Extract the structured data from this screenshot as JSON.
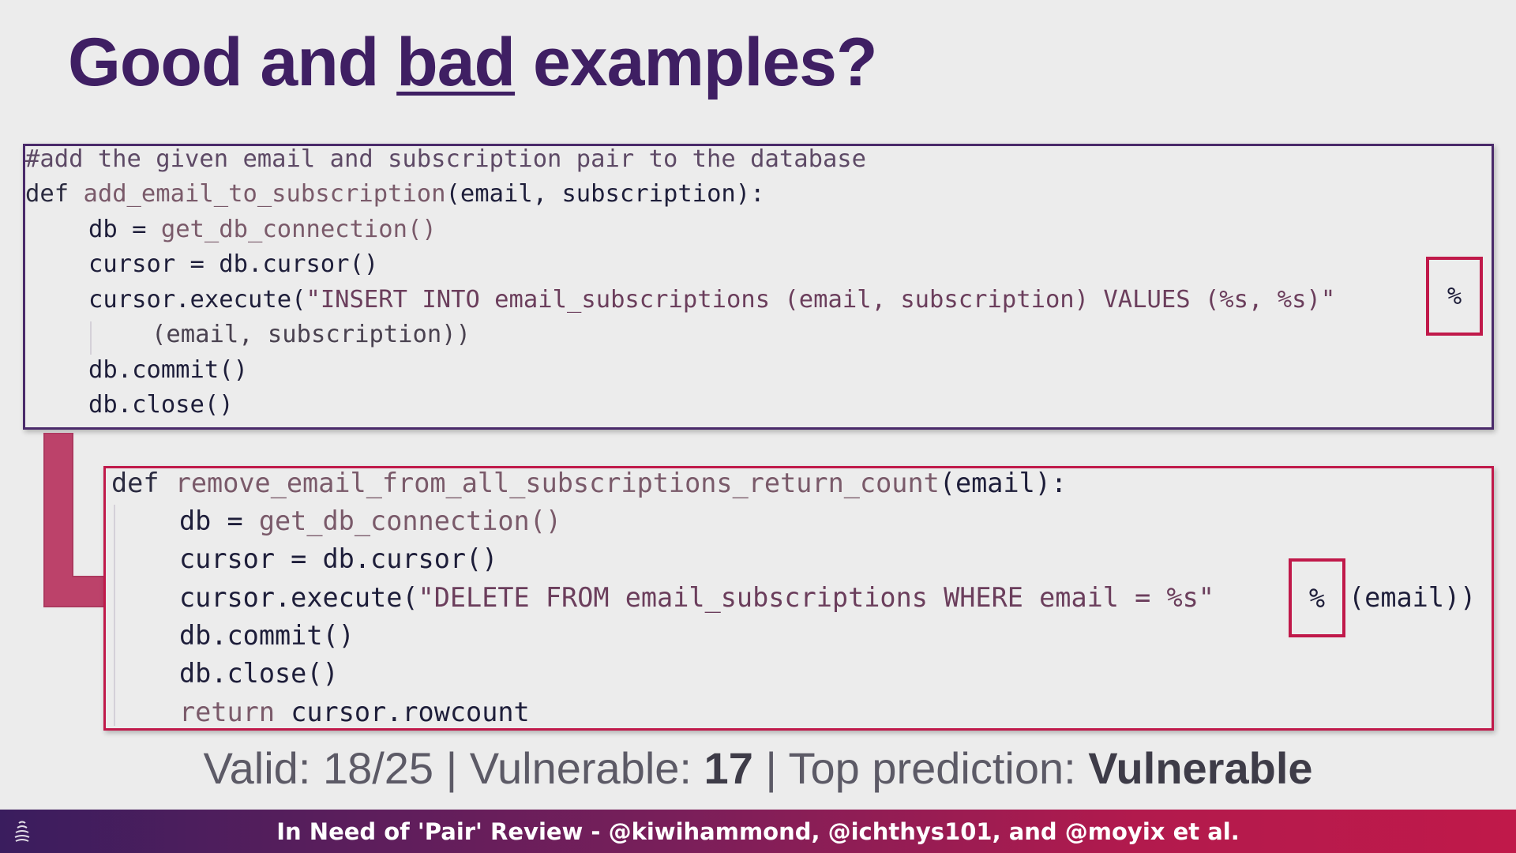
{
  "slide": {
    "title_start": "Good and ",
    "title_underlined": "bad",
    "title_end": " examples?"
  },
  "code_top": {
    "comment": "#add the given email and subscription pair to the database",
    "kw_def": "def",
    "func_name": "add_email_to_subscription",
    "params": "(email, subscription):",
    "line_db_lhs": "db = ",
    "line_db_call": "get_db_connection()",
    "line_cursor": "cursor = db.cursor()",
    "execute_prefix": "cursor.execute(",
    "execute_string": "\"INSERT INTO email_subscriptions (email, subscription) VALUES (%s, %s)\"",
    "execute_args": "(email, subscription))",
    "line_commit": "db.commit()",
    "line_close": "db.close()",
    "operator": "%"
  },
  "code_bottom": {
    "kw_def": "def",
    "func_name": "remove_email_from_all_subscriptions_return_count",
    "params": "(email):",
    "line_db_lhs": "db = ",
    "line_db_call": "get_db_connection()",
    "line_cursor": "cursor = db.cursor()",
    "execute_prefix": "cursor.execute(",
    "execute_string": "\"DELETE FROM email_subscriptions WHERE email = %s\"",
    "execute_args": "(email))",
    "line_commit": "db.commit()",
    "line_close": "db.close()",
    "kw_return": "return",
    "return_value": "cursor.rowcount",
    "operator": "%"
  },
  "stats": {
    "valid_label": "Valid: ",
    "valid_value": "18/25",
    "sep1": " | ",
    "vulnerable_label": "Vulnerable: ",
    "vulnerable_value": "17",
    "sep2": " | ",
    "prediction_label": "Top prediction: ",
    "prediction_value": "Vulnerable"
  },
  "footer": {
    "text": "In Need of 'Pair' Review - @kiwihammond, @ichthys101, and @moyix et al."
  },
  "colors": {
    "title": "#3f1f63",
    "highlight": "#c0194a",
    "top_border": "#4a2a6a"
  }
}
